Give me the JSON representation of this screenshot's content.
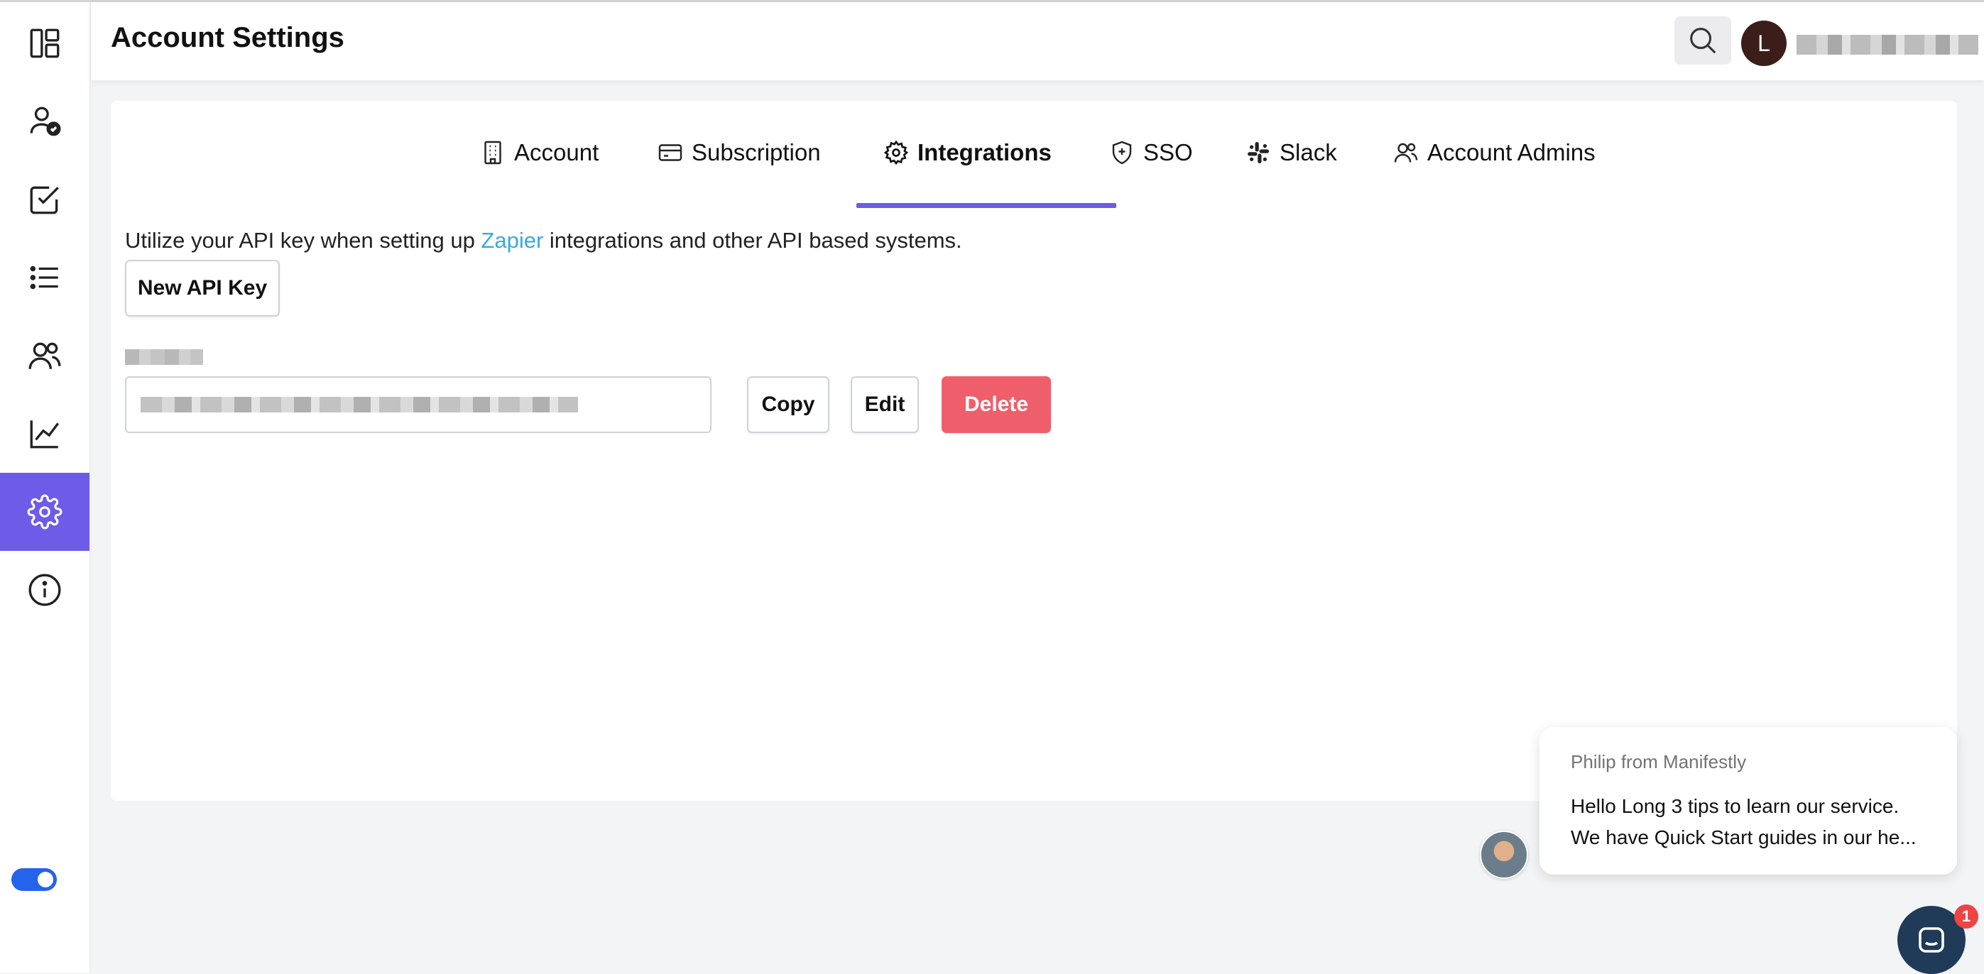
{
  "header": {
    "title": "Account Settings",
    "avatar_initial": "L"
  },
  "sidebar": {
    "items": [
      {
        "icon": "dashboard-icon"
      },
      {
        "icon": "user-check-icon"
      },
      {
        "icon": "checklist-icon"
      },
      {
        "icon": "list-icon"
      },
      {
        "icon": "users-icon"
      },
      {
        "icon": "chart-icon"
      },
      {
        "icon": "gear-icon",
        "active": true
      },
      {
        "icon": "info-icon"
      }
    ],
    "toggle_on": true
  },
  "tabs": [
    {
      "label": "Account",
      "icon": "building-icon"
    },
    {
      "label": "Subscription",
      "icon": "credit-card-icon"
    },
    {
      "label": "Integrations",
      "icon": "gear-icon",
      "active": true
    },
    {
      "label": "SSO",
      "icon": "shield-icon"
    },
    {
      "label": "Slack",
      "icon": "slack-icon"
    },
    {
      "label": "Account Admins",
      "icon": "users-icon"
    }
  ],
  "integrations": {
    "description_prefix": "Utilize your API key when setting up ",
    "description_link": "Zapier",
    "description_suffix": " integrations and other API based systems.",
    "new_key_label": "New API Key",
    "copy_label": "Copy",
    "edit_label": "Edit",
    "delete_label": "Delete"
  },
  "chat": {
    "from": "Philip from Manifestly",
    "line1": "Hello Long 3 tips to learn our service.",
    "line2": "We have Quick Start guides in our he...",
    "badge_count": "1"
  },
  "colors": {
    "accent": "#6c5ce7",
    "danger": "#ef5f6b",
    "link": "#38a9e0",
    "toggle": "#2563eb"
  }
}
